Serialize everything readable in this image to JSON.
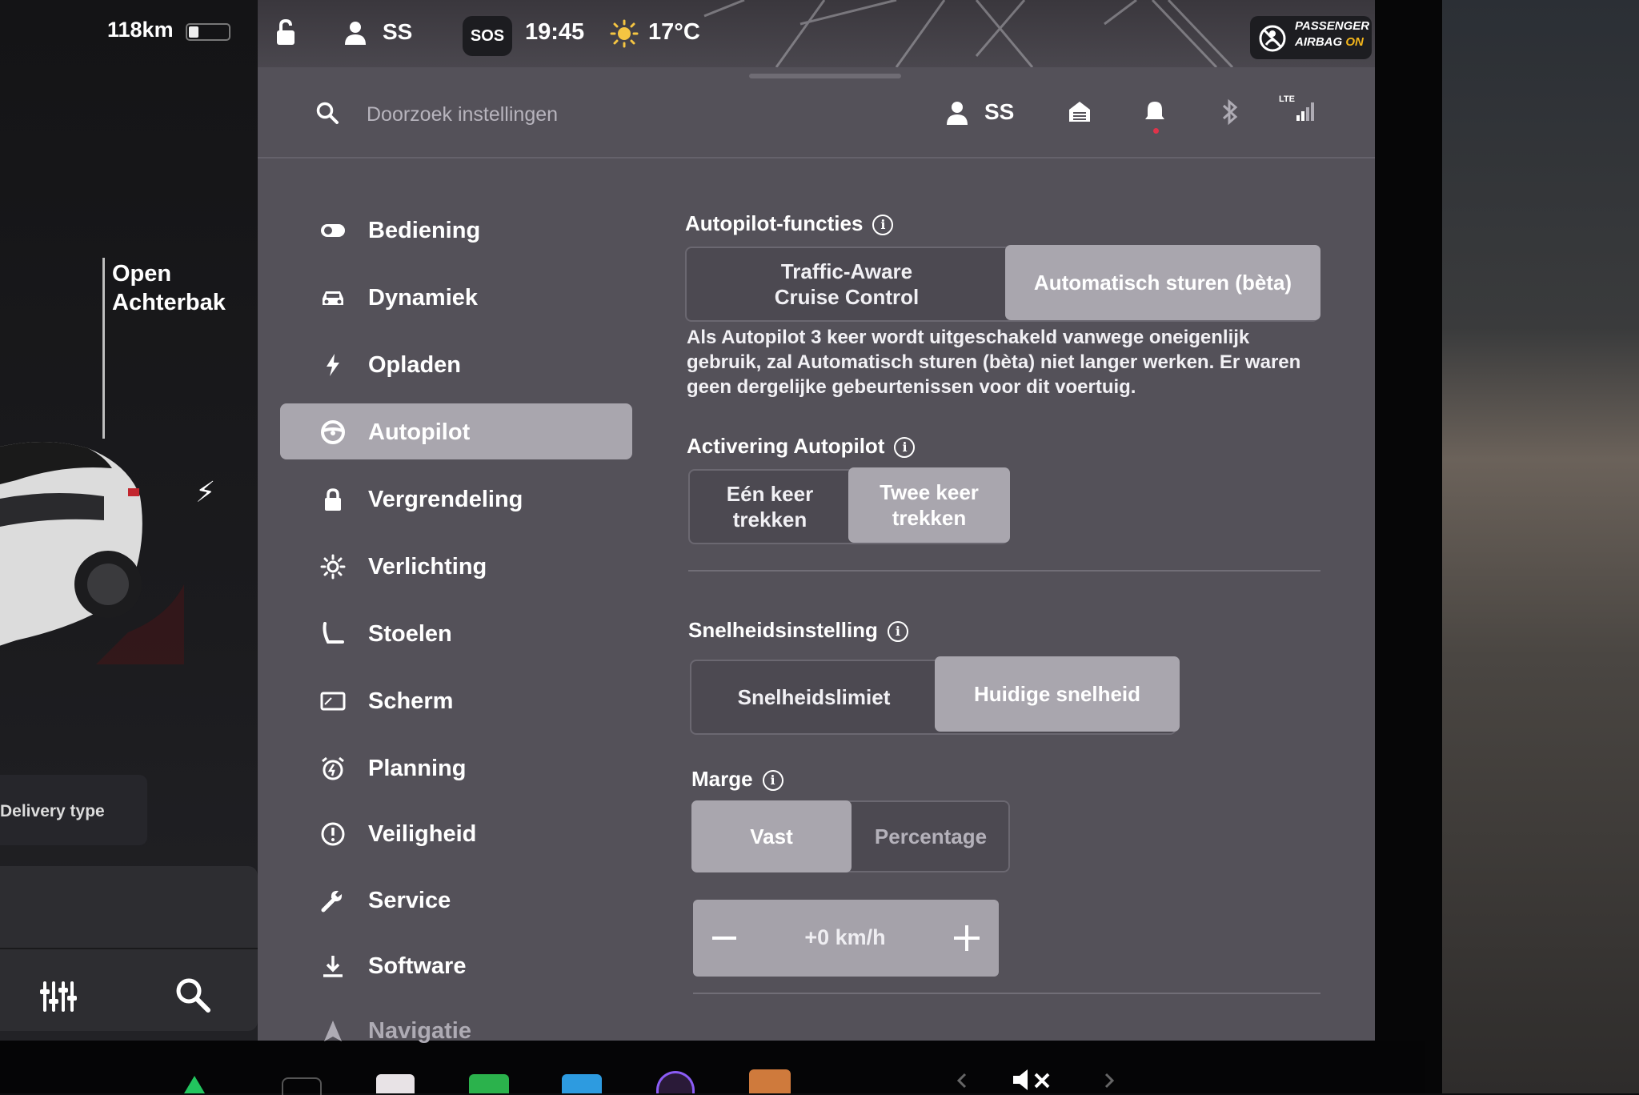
{
  "status_bar": {
    "range": "118km",
    "profile": "SS",
    "sos": "SOS",
    "time": "19:45",
    "temperature": "17°C",
    "airbag_line1": "PASSENGER",
    "airbag_line2": "AIRBAG",
    "airbag_state": "ON"
  },
  "car_panel": {
    "trunk_line1": "Open",
    "trunk_line2": "Achterbak",
    "delivery_type": "Delivery type"
  },
  "header": {
    "search_placeholder": "Doorzoek instellingen",
    "profile": "SS",
    "network": "LTE"
  },
  "sidebar": {
    "items": [
      {
        "label": "Bediening",
        "icon": "toggle-icon"
      },
      {
        "label": "Dynamiek",
        "icon": "car-icon"
      },
      {
        "label": "Opladen",
        "icon": "bolt-icon"
      },
      {
        "label": "Autopilot",
        "icon": "steering-wheel-icon",
        "active": true
      },
      {
        "label": "Vergrendeling",
        "icon": "lock-icon"
      },
      {
        "label": "Verlichting",
        "icon": "light-icon"
      },
      {
        "label": "Stoelen",
        "icon": "seat-icon"
      },
      {
        "label": "Scherm",
        "icon": "screen-icon"
      },
      {
        "label": "Planning",
        "icon": "alarm-icon"
      },
      {
        "label": "Veiligheid",
        "icon": "alert-icon"
      },
      {
        "label": "Service",
        "icon": "wrench-icon"
      },
      {
        "label": "Software",
        "icon": "download-icon"
      },
      {
        "label": "Navigatie",
        "icon": "navigation-icon"
      }
    ]
  },
  "autopilot_features": {
    "title": "Autopilot-functies",
    "option1_line1": "Traffic-Aware",
    "option1_line2": "Cruise Control",
    "option2": "Automatisch sturen (bèta)",
    "selected": "Automatisch sturen (bèta)",
    "description": "Als Autopilot 3 keer wordt uitgeschakeld vanwege oneigenlijk gebruik, zal Automatisch sturen (bèta) niet langer werken. Er waren geen dergelijke gebeurtenissen voor dit voertuig."
  },
  "activation": {
    "title": "Activering Autopilot",
    "option1_line1": "Eén keer",
    "option1_line2": "trekken",
    "option2_line1": "Twee keer",
    "option2_line2": "trekken",
    "selected": "Twee keer trekken"
  },
  "speed_setting": {
    "title": "Snelheidsinstelling",
    "option1": "Snelheidslimiet",
    "option2": "Huidige snelheid",
    "selected": "Huidige snelheid"
  },
  "margin": {
    "title": "Marge",
    "option1": "Vast",
    "option2": "Percentage",
    "selected": "Vast",
    "value": "+0 km/h"
  },
  "colors": {
    "screen_bg": "#545159",
    "selected_option": "#a9a6ae",
    "airbag_on": "#f3b51b",
    "notification_dot": "#e0334a"
  }
}
